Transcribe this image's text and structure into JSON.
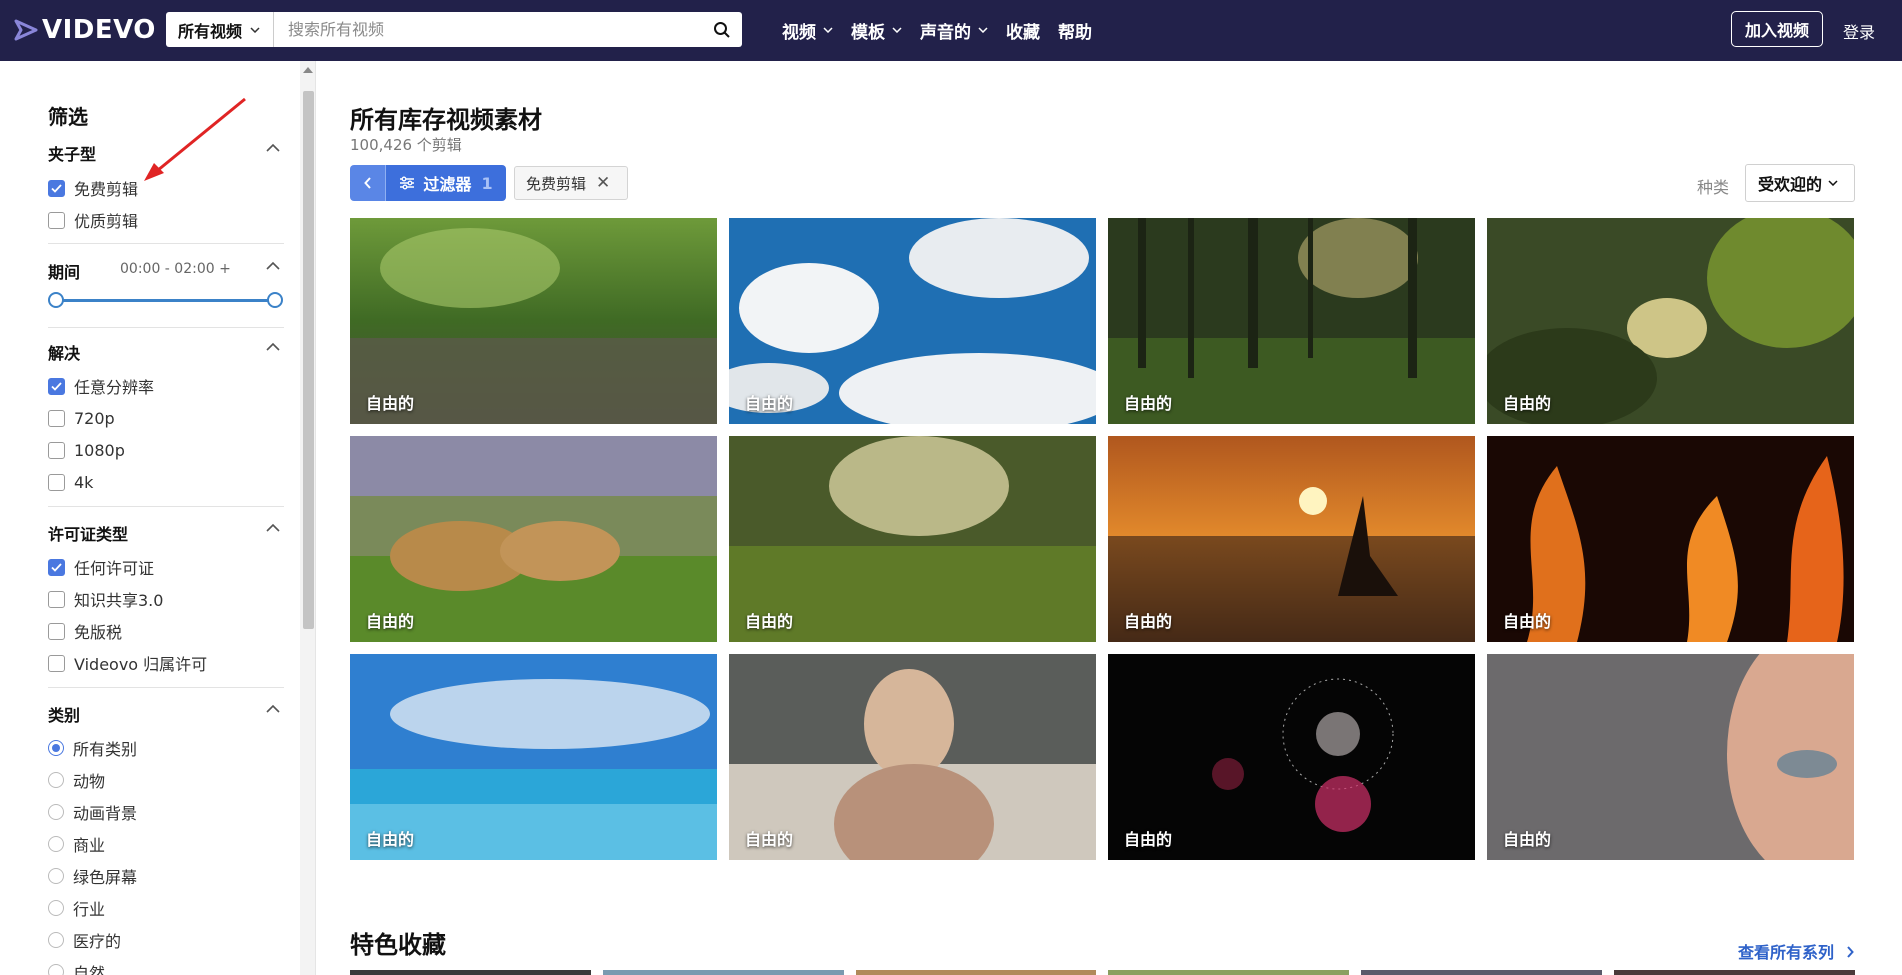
{
  "header": {
    "logo": "VIDEVO",
    "search_scope": "所有视频",
    "search_placeholder": "搜索所有视频",
    "nav": [
      "视频",
      "模板",
      "声音的",
      "收藏",
      "帮助"
    ],
    "join_label": "加入视频",
    "login_label": "登录"
  },
  "sidebar": {
    "title": "筛选",
    "clip_type": {
      "title": "夹子型",
      "options": [
        {
          "label": "免费剪辑",
          "checked": true
        },
        {
          "label": "优质剪辑",
          "checked": false
        }
      ]
    },
    "duration": {
      "title": "期间",
      "range": "00:00 - 02:00 +"
    },
    "resolution": {
      "title": "解决",
      "options": [
        {
          "label": "任意分辨率",
          "checked": true
        },
        {
          "label": "720p",
          "checked": false
        },
        {
          "label": "1080p",
          "checked": false
        },
        {
          "label": "4k",
          "checked": false
        }
      ]
    },
    "license": {
      "title": "许可证类型",
      "options": [
        {
          "label": "任何许可证",
          "checked": true
        },
        {
          "label": "知识共享3.0",
          "checked": false
        },
        {
          "label": "免版税",
          "checked": false
        },
        {
          "label": "Videovo 归属许可",
          "checked": false
        }
      ]
    },
    "category": {
      "title": "类别",
      "options": [
        {
          "label": "所有类别",
          "selected": true
        },
        {
          "label": "动物",
          "selected": false
        },
        {
          "label": "动画背景",
          "selected": false
        },
        {
          "label": "商业",
          "selected": false
        },
        {
          "label": "绿色屏幕",
          "selected": false
        },
        {
          "label": "行业",
          "selected": false
        },
        {
          "label": "医疗的",
          "selected": false
        },
        {
          "label": "自然",
          "selected": false
        }
      ]
    }
  },
  "main": {
    "title": "所有库存视频素材",
    "count": "100,426 个剪辑",
    "filter_label": "过滤器",
    "filter_count": "1",
    "active_chip": "免费剪辑",
    "sort_label": "种类",
    "sort_value": "受欢迎的",
    "tiles": [
      {
        "label": "自由的"
      },
      {
        "label": "自由的"
      },
      {
        "label": "自由的"
      },
      {
        "label": "自由的"
      },
      {
        "label": "自由的"
      },
      {
        "label": "自由的"
      },
      {
        "label": "自由的"
      },
      {
        "label": "自由的"
      },
      {
        "label": "自由的"
      },
      {
        "label": "自由的"
      },
      {
        "label": "自由的"
      },
      {
        "label": "自由的"
      }
    ],
    "featured_title": "特色收藏",
    "see_all": "查看所有系列"
  },
  "colors": {
    "header_bg": "#22214a",
    "accent": "#3d6fdc",
    "link": "#2f62c9"
  }
}
